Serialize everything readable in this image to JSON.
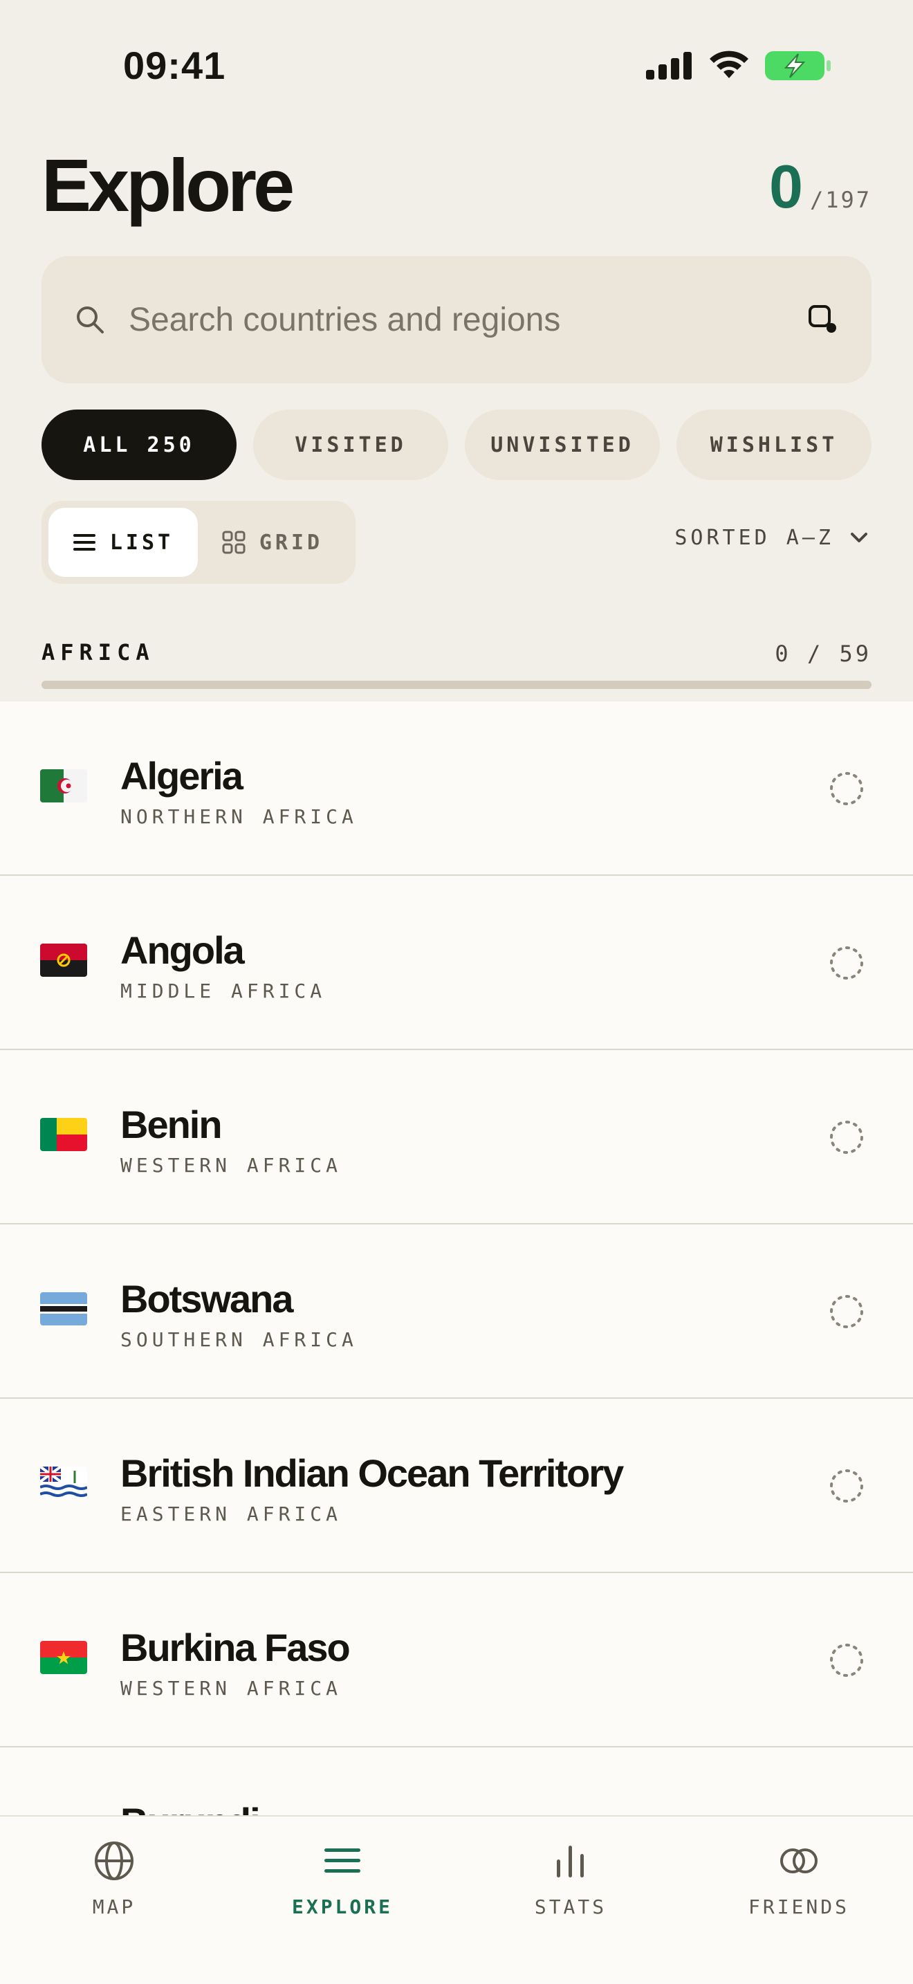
{
  "status_bar": {
    "time": "09:41"
  },
  "header": {
    "title": "Explore",
    "visited_count": "0",
    "total_count": "/197"
  },
  "search": {
    "placeholder": "Search countries and regions"
  },
  "filters": [
    {
      "label": "ALL 250",
      "active": true
    },
    {
      "label": "VISITED",
      "active": false
    },
    {
      "label": "UNVISITED",
      "active": false
    },
    {
      "label": "WISHLIST",
      "active": false
    }
  ],
  "view_toggle": {
    "list_label": "LIST",
    "grid_label": "GRID",
    "active": "list"
  },
  "sort": {
    "label": "SORTED A–Z"
  },
  "section": {
    "title": "AFRICA",
    "count": "0 / 59",
    "progress": 0
  },
  "countries": [
    {
      "name": "Algeria",
      "region": "NORTHERN AFRICA",
      "flag_icon": "algeria-flag-icon"
    },
    {
      "name": "Angola",
      "region": "MIDDLE AFRICA",
      "flag_icon": "angola-flag-icon"
    },
    {
      "name": "Benin",
      "region": "WESTERN AFRICA",
      "flag_icon": "benin-flag-icon"
    },
    {
      "name": "Botswana",
      "region": "SOUTHERN AFRICA",
      "flag_icon": "botswana-flag-icon"
    },
    {
      "name": "British Indian Ocean Territory",
      "region": "EASTERN AFRICA",
      "flag_icon": "british-indian-ocean-territory-flag-icon"
    },
    {
      "name": "Burkina Faso",
      "region": "WESTERN AFRICA",
      "flag_icon": "burkina-faso-flag-icon"
    },
    {
      "name": "Burundi",
      "region": "",
      "flag_icon": "burundi-flag-icon"
    }
  ],
  "tabs": [
    {
      "label": "MAP",
      "icon": "globe-icon",
      "active": false
    },
    {
      "label": "EXPLORE",
      "icon": "list-icon",
      "active": true
    },
    {
      "label": "STATS",
      "icon": "bar-chart-icon",
      "active": false
    },
    {
      "label": "FRIENDS",
      "icon": "overlapping-circles-icon",
      "active": false
    }
  ],
  "colors": {
    "background": "#f2efe8",
    "list_background": "#fcfbf7",
    "accent_green": "#1b6f54",
    "ink": "#161510",
    "chip_background": "#ebe5da",
    "battery_green": "#4cd964"
  }
}
